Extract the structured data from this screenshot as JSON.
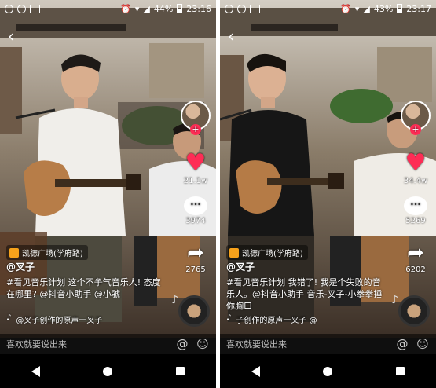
{
  "screens": [
    {
      "status": {
        "battery": "44%",
        "time": "23:16"
      },
      "location": "凯德广场(学府路)",
      "username": "@叉子",
      "caption": "#看见音乐计划 这个不争气音乐人! 态度在哪里? @抖音小助手 @小虢",
      "music": "@叉子创作的原声一叉子",
      "likes": "21.1w",
      "comments": "3974",
      "shares": "2765",
      "comment_placeholder": "喜欢就要说出来"
    },
    {
      "status": {
        "battery": "43%",
        "time": "23:17"
      },
      "location": "凯德广场(学府路)",
      "username": "@叉子",
      "caption": "#看见音乐计划 我错了! 我是个失败的音乐人。@抖音小助手 音乐-叉子-小拳拳捶你胸口",
      "music": "子创作的原声一叉子  @",
      "likes": "34.4w",
      "comments": "5269",
      "shares": "6202",
      "comment_placeholder": "喜欢就要说出来"
    }
  ],
  "colors": {
    "like": "#fe2c55",
    "location_icon": "#f7a21b"
  }
}
